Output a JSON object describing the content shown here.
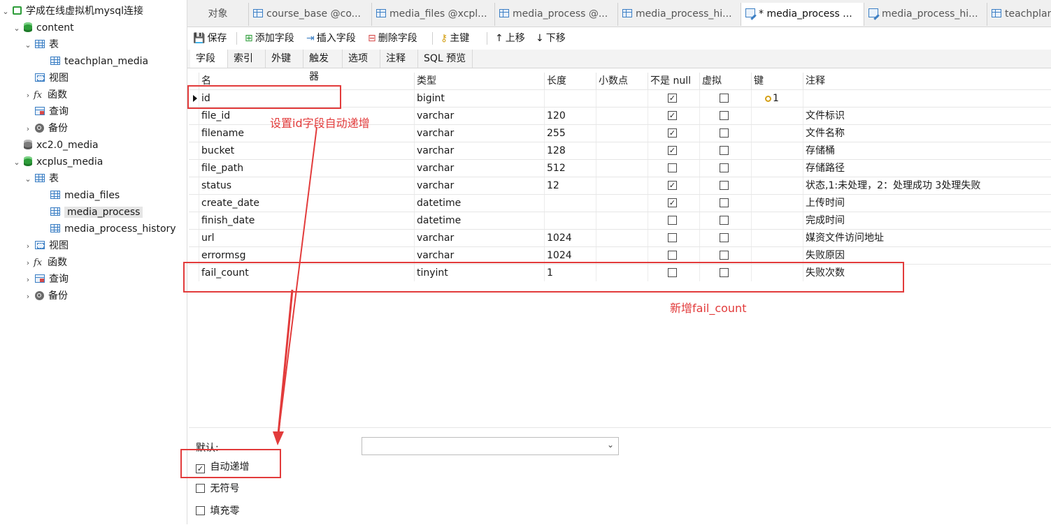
{
  "sidebar": {
    "connection": "学成在线虚拟机mysql连接",
    "db1": {
      "name": "content",
      "tables_label": "表",
      "tables": [
        "teachplan_media"
      ],
      "views_label": "视图",
      "functions_label": "函数",
      "queries_label": "查询",
      "backups_label": "备份"
    },
    "db2": {
      "name": "xc2.0_media"
    },
    "db3": {
      "name": "xcplus_media",
      "tables_label": "表",
      "tables": [
        "media_files",
        "media_process",
        "media_process_history"
      ],
      "views_label": "视图",
      "functions_label": "函数",
      "queries_label": "查询",
      "backups_label": "备份"
    }
  },
  "tabs": [
    "对象",
    "course_base @co...",
    "media_files @xcpl...",
    "media_process @...",
    "media_process_hi...",
    "* media_process ...",
    "media_process_hi...",
    "teachplan"
  ],
  "toolbar": {
    "save": "保存",
    "add_field": "添加字段",
    "insert_field": "插入字段",
    "delete_field": "删除字段",
    "primary_key": "主键",
    "move_up": "上移",
    "move_down": "下移"
  },
  "subtabs": [
    "字段",
    "索引",
    "外键",
    "触发器",
    "选项",
    "注释",
    "SQL 预览"
  ],
  "columns": [
    "名",
    "类型",
    "长度",
    "小数点",
    "不是 null",
    "虚拟",
    "键",
    "注释"
  ],
  "rows": [
    {
      "name": "id",
      "type": "bigint",
      "length": "",
      "decimals": "",
      "not_null": true,
      "virtual": false,
      "key": "1",
      "comment": ""
    },
    {
      "name": "file_id",
      "type": "varchar",
      "length": "120",
      "decimals": "",
      "not_null": true,
      "virtual": false,
      "key": "",
      "comment": "文件标识"
    },
    {
      "name": "filename",
      "type": "varchar",
      "length": "255",
      "decimals": "",
      "not_null": true,
      "virtual": false,
      "key": "",
      "comment": "文件名称"
    },
    {
      "name": "bucket",
      "type": "varchar",
      "length": "128",
      "decimals": "",
      "not_null": true,
      "virtual": false,
      "key": "",
      "comment": "存储桶"
    },
    {
      "name": "file_path",
      "type": "varchar",
      "length": "512",
      "decimals": "",
      "not_null": false,
      "virtual": false,
      "key": "",
      "comment": "存储路径"
    },
    {
      "name": "status",
      "type": "varchar",
      "length": "12",
      "decimals": "",
      "not_null": true,
      "virtual": false,
      "key": "",
      "comment": "状态,1:未处理，2：处理成功  3处理失败"
    },
    {
      "name": "create_date",
      "type": "datetime",
      "length": "",
      "decimals": "",
      "not_null": true,
      "virtual": false,
      "key": "",
      "comment": "上传时间"
    },
    {
      "name": "finish_date",
      "type": "datetime",
      "length": "",
      "decimals": "",
      "not_null": false,
      "virtual": false,
      "key": "",
      "comment": "完成时间"
    },
    {
      "name": "url",
      "type": "varchar",
      "length": "1024",
      "decimals": "",
      "not_null": false,
      "virtual": false,
      "key": "",
      "comment": "媒资文件访问地址"
    },
    {
      "name": "errormsg",
      "type": "varchar",
      "length": "1024",
      "decimals": "",
      "not_null": false,
      "virtual": false,
      "key": "",
      "comment": "失败原因"
    },
    {
      "name": "fail_count",
      "type": "tinyint",
      "length": "1",
      "decimals": "",
      "not_null": false,
      "virtual": false,
      "key": "",
      "comment": "失败次数"
    }
  ],
  "bottom": {
    "default_label": "默认:",
    "default_value": "",
    "auto_increment": {
      "label": "自动递增",
      "checked": true
    },
    "unsigned": {
      "label": "无符号",
      "checked": false
    },
    "zerofill": {
      "label": "填充零",
      "checked": false
    }
  },
  "annotations": {
    "id_note": "设置id字段自动递增",
    "new_field_note": "新增fail_count"
  },
  "colors": {
    "annotation": "#e23b3b",
    "key_icon": "#d4a017",
    "db_green": "#2e9d3a"
  }
}
